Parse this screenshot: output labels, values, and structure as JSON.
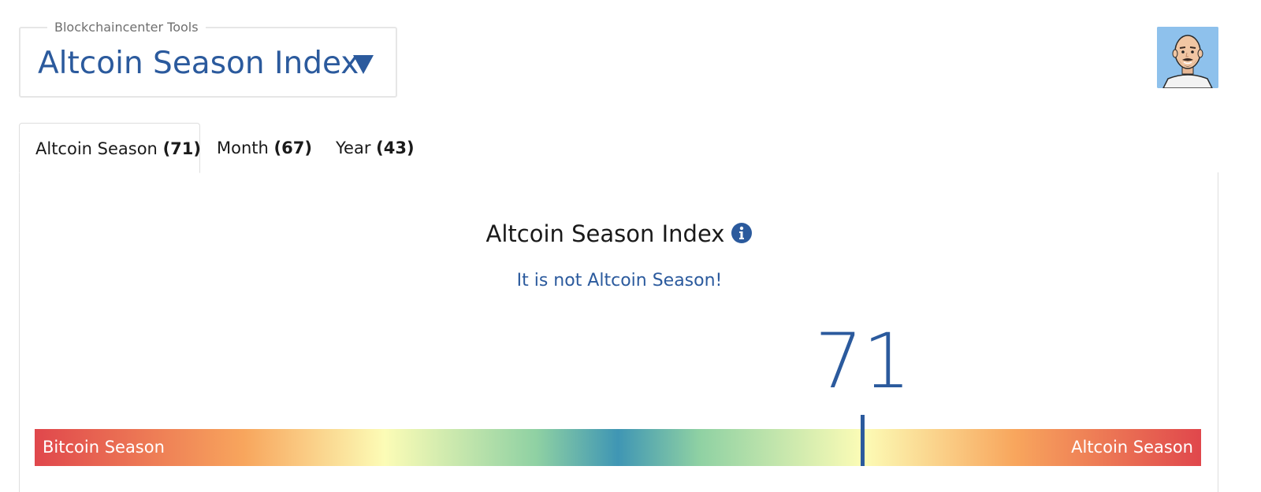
{
  "tool_selector": {
    "legend": "Blockchaincenter Tools",
    "title": "Altcoin Season Index",
    "caret_icon": "caret-down-icon"
  },
  "avatar": {
    "icon": "user-avatar"
  },
  "tabs": [
    {
      "label": "Altcoin Season",
      "value": "(71)",
      "active": true
    },
    {
      "label": "Month",
      "value": "(67)",
      "active": false
    },
    {
      "label": "Year",
      "value": "(43)",
      "active": false
    }
  ],
  "panel": {
    "heading": "Altcoin Season Index",
    "info_icon": "info-icon",
    "status": "It is not Altcoin Season!",
    "index_value": "71",
    "scale": {
      "left_label": "Bitcoin Season",
      "right_label": "Altcoin Season",
      "min": 0,
      "max": 100,
      "current": 71
    }
  },
  "colors": {
    "accent": "#2b5a9d",
    "gradient": [
      "#e0474c",
      "#f8a65d",
      "#fcfcb6",
      "#8fd1a3",
      "#3f96b4",
      "#8fd1a3",
      "#fcfcb6",
      "#f8a65d",
      "#e0474c"
    ]
  }
}
